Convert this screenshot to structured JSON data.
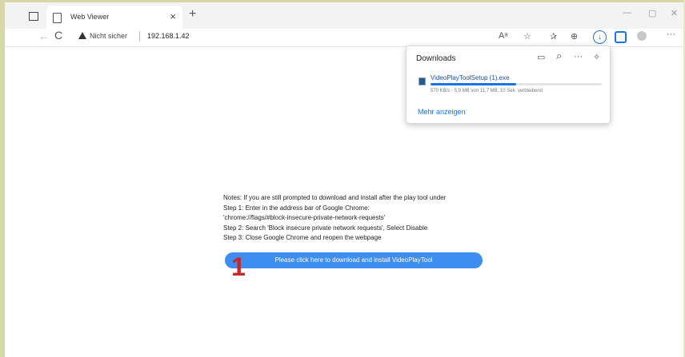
{
  "tab": {
    "title": "Web Viewer",
    "close": "×",
    "new_tab": "+"
  },
  "window_controls": {
    "minimize": "—",
    "maximize": "▢",
    "close": "✕"
  },
  "address_bar": {
    "back": "←",
    "refresh": "C",
    "security_label": "Nicht sicher",
    "url": "192.168.1.42"
  },
  "toolbar": {
    "read_aloud": "Aᵃ",
    "favorites_add": "☆",
    "favorites": "✰",
    "collections": "⊕",
    "download": "↓",
    "more": "···"
  },
  "downloads_panel": {
    "title": "Downloads",
    "folder_icon": "▭",
    "search_icon": "⌕",
    "more_icon": "···",
    "pin_icon": "✧",
    "file_name": "VideoPlayToolSetup (1).exe",
    "progress_fraction": 0.5,
    "status": "570 KB/s - 5,9 MB von 11,7 MB, 10 Sek. verbleibend",
    "show_more": "Mehr anzeigen"
  },
  "page": {
    "notes": [
      "Notes: If you are still prompted to download and install after the play tool under",
      "Step 1: Enter in the address bar of Google Chrome:",
      "'chrome://flags/#block-insecure-private-network-requests'",
      "Step 2: Search 'Block insecure private network requests',  Select Disable",
      "Step 3: Close Google Chrome and reopen the webpage"
    ],
    "cta": "Please click here to download and install VideoPlayTool",
    "annotation": "1"
  },
  "colors": {
    "accent": "#1a73e8",
    "cta": "#3d8ef0",
    "annotation": "#c62828"
  }
}
